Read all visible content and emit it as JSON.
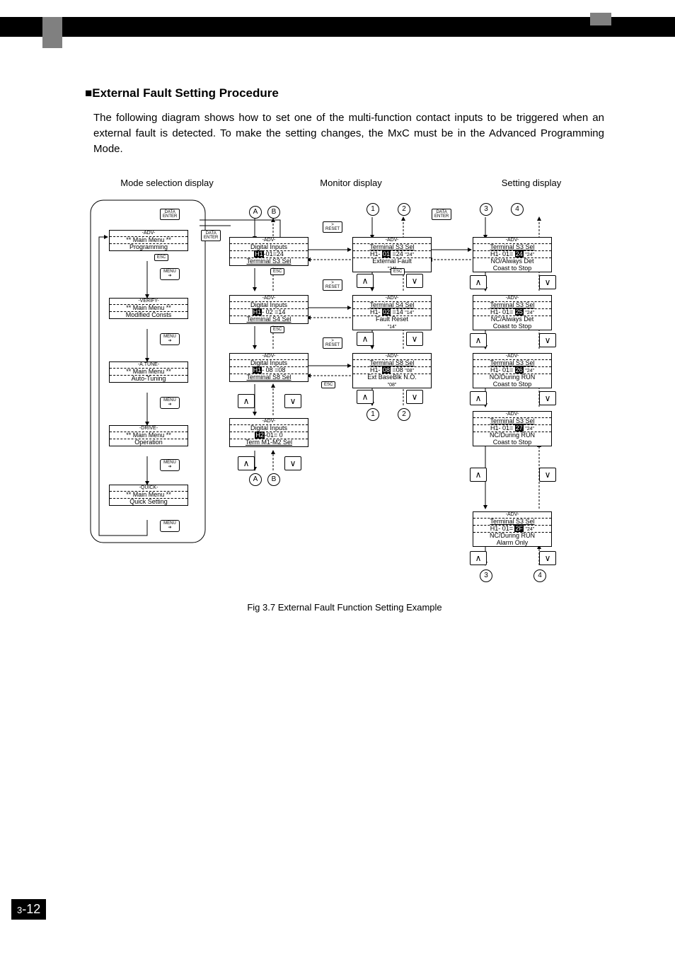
{
  "header": {
    "section_title": "■External Fault Setting Procedure",
    "paragraph": "The following diagram shows how to set one of the multi-function contact inputs to be triggered when an external fault is detected. To make the setting changes, the MxC must be in the Advanced Programming Mode."
  },
  "col_labels": {
    "mode": "Mode selection display",
    "monitor": "Monitor display",
    "setting": "Setting display"
  },
  "btns": {
    "data_enter": "DATA\nENTER",
    "reset": ">\nRESET",
    "esc": "ESC",
    "menu": "MENU"
  },
  "circles": {
    "A": "A",
    "B": "B",
    "1": "1",
    "2": "2",
    "3": "3",
    "4": "4"
  },
  "left": [
    {
      "h": "-ADV-",
      "m1": "** Main Menu **",
      "f": "Programming"
    },
    {
      "h": "-VERIFY-",
      "m1": "** Main Menu **",
      "f": "Modified Consts"
    },
    {
      "h": "-A.TUNE-",
      "m1": "** Main Menu **",
      "f": "Auto-Tuning"
    },
    {
      "h": "-DRIVE-",
      "m1": "** Main Menu **",
      "f": "Operation"
    },
    {
      "h": "-QUICK-",
      "m1": "** Main Menu **",
      "f": "Quick Setting"
    }
  ],
  "mid": [
    {
      "h": "-ADV-",
      "m1": "Digital Inputs",
      "m2pre": "H1",
      "m2": "-01=24",
      "f": "Terminal S3 Sel"
    },
    {
      "h": "-ADV-",
      "m1": "Digital Inputs",
      "m2pre": "H1",
      "m2": "- 02 =14",
      "f": "Terminal S4 Sel"
    },
    {
      "h": "-ADV-",
      "m1": "Digital Inputs",
      "m2pre": "H1",
      "m2": "- 08 =08",
      "f": "Terminal S8 Sel"
    },
    {
      "h": "-ADV-",
      "m1": "Digital Inputs",
      "m2pre": "H2",
      "m2": "-01= 0",
      "f": "Term M1-M2 Sel"
    }
  ],
  "mon": [
    {
      "h": "-ADV-",
      "m1": "Terminal S3 Sel",
      "m2a": "H1- ",
      "m2b": "01",
      "m2c": " =24",
      "m2d": "\"24\"",
      "f": "External Fault",
      "ff": "\"24\""
    },
    {
      "h": "-ADV-",
      "m1": "Terminal S4 Sel",
      "m2a": "H1- ",
      "m2b": "02",
      "m2c": " =14",
      "m2d": "\"14\"",
      "f": "Fault Reset",
      "ff": "\"14\""
    },
    {
      "h": "-ADV-",
      "m1": "Terminal S8 Sel",
      "m2a": "H1- ",
      "m2b": "08",
      "m2c": " =08",
      "m2d": "\"08\"",
      "f": "Ext BaseBlk N.O.",
      "ff": "\"08\""
    }
  ],
  "set": [
    {
      "h": "-ADV-",
      "m1": "Terminal S3 Sel",
      "m2a": "H1- 01= ",
      "m2b": "24",
      "m2d": "\"24\"",
      "f1": "NO/Always Det",
      "f2": "Coast to Stop"
    },
    {
      "h": "-ADV-",
      "m1": "Terminal S3 Sel",
      "m2a": "H1- 01= ",
      "m2b": "25",
      "m2d": "\"24\"",
      "f1": "NC/Always Det",
      "f2": "Coast to Stop"
    },
    {
      "h": "-ADV-",
      "m1": "Terminal S3 Sel",
      "m2a": "H1- 01= ",
      "m2b": "26",
      "m2d": "\"24\"",
      "f1": "NO/During RUN",
      "f2": "Coast to Stop"
    },
    {
      "h": "-ADV-",
      "m1": "Terminal S3 Sel",
      "m2a": "H1- 01= ",
      "m2b": "27",
      "m2d": "\"24\"",
      "f1": "NC/During RUN",
      "f2": "Coast to Stop"
    },
    {
      "h": "-ADV-",
      "m1": "Terminal S3 Sel",
      "m2a": "H1- 01= ",
      "m2b": "2F",
      "m2d": "\"24\"",
      "f1": "NC/During RUN",
      "f2": "Alarm Only"
    }
  ],
  "caption": "Fig 3.7  External Fault Function Setting Example",
  "page": {
    "pre": "3",
    "num": "12"
  }
}
